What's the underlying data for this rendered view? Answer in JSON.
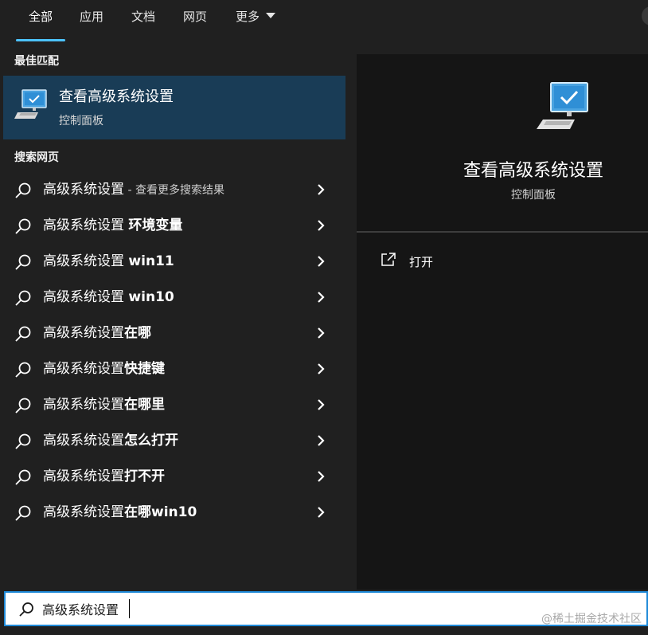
{
  "tabs": [
    {
      "label": "全部",
      "active": true
    },
    {
      "label": "应用",
      "active": false
    },
    {
      "label": "文档",
      "active": false
    },
    {
      "label": "网页",
      "active": false
    },
    {
      "label": "更多",
      "active": false
    }
  ],
  "best_match": {
    "section_title": "最佳匹配",
    "title": "查看高级系统设置",
    "subtitle": "控制面板",
    "icon": "monitor-settings-icon"
  },
  "web_search": {
    "section_title": "搜索网页",
    "results": [
      {
        "prefix": "高级系统设置",
        "bold": "",
        "hint": " - 查看更多搜索结果"
      },
      {
        "prefix": "高级系统设置 ",
        "bold": "环境变量",
        "hint": ""
      },
      {
        "prefix": "高级系统设置 ",
        "bold": "win11",
        "hint": ""
      },
      {
        "prefix": "高级系统设置 ",
        "bold": "win10",
        "hint": ""
      },
      {
        "prefix": "高级系统设置",
        "bold": "在哪",
        "hint": ""
      },
      {
        "prefix": "高级系统设置",
        "bold": "快捷键",
        "hint": ""
      },
      {
        "prefix": "高级系统设置",
        "bold": "在哪里",
        "hint": ""
      },
      {
        "prefix": "高级系统设置",
        "bold": "怎么打开",
        "hint": ""
      },
      {
        "prefix": "高级系统设置",
        "bold": "打不开",
        "hint": ""
      },
      {
        "prefix": "高级系统设置",
        "bold": "在哪win10",
        "hint": ""
      }
    ]
  },
  "detail": {
    "title": "查看高级系统设置",
    "subtitle": "控制面板",
    "open_label": "打开"
  },
  "search": {
    "value": "高级系统设置"
  },
  "watermark": "@稀土掘金技术社区",
  "colors": {
    "accent": "#4cc2ff",
    "selected_bg": "#193c56",
    "panel_bg": "#202020",
    "detail_bg": "#151515",
    "search_border": "#1f8ad8"
  }
}
